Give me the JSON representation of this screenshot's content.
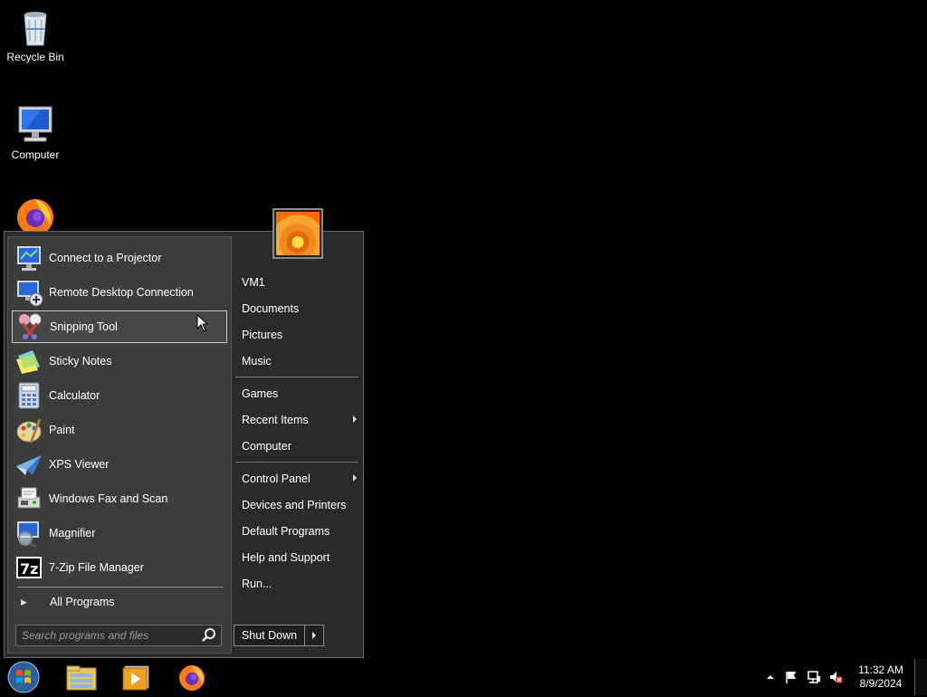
{
  "desktop": {
    "icons": [
      {
        "label": "Recycle Bin",
        "icon": "recycle-bin-icon"
      },
      {
        "label": "Computer",
        "icon": "computer-icon"
      },
      {
        "label": "",
        "icon": "firefox-icon"
      }
    ]
  },
  "start_menu": {
    "programs": [
      {
        "label": "Connect to a Projector",
        "icon": "projector-icon"
      },
      {
        "label": "Remote Desktop Connection",
        "icon": "remote-desktop-icon"
      },
      {
        "label": "Snipping Tool",
        "icon": "scissors-icon",
        "selected": true
      },
      {
        "label": "Sticky Notes",
        "icon": "sticky-notes-icon"
      },
      {
        "label": "Calculator",
        "icon": "calculator-icon"
      },
      {
        "label": "Paint",
        "icon": "paint-palette-icon"
      },
      {
        "label": "XPS Viewer",
        "icon": "paper-plane-icon"
      },
      {
        "label": "Windows Fax and Scan",
        "icon": "fax-icon"
      },
      {
        "label": "Magnifier",
        "icon": "magnifier-icon"
      },
      {
        "label": "7-Zip File Manager",
        "icon": "7zip-icon"
      }
    ],
    "all_programs_label": "All Programs",
    "search_placeholder": "Search programs and files",
    "right_items": [
      {
        "label": "VM1",
        "has_submenu": false
      },
      {
        "label": "Documents",
        "has_submenu": false
      },
      {
        "label": "Pictures",
        "has_submenu": false
      },
      {
        "label": "Music",
        "has_submenu": false
      },
      {
        "label": "Games",
        "has_submenu": false
      },
      {
        "label": "Recent Items",
        "has_submenu": true
      },
      {
        "label": "Computer",
        "has_submenu": false
      },
      {
        "label": "Control Panel",
        "has_submenu": true
      },
      {
        "label": "Devices and Printers",
        "has_submenu": false
      },
      {
        "label": "Default Programs",
        "has_submenu": false
      },
      {
        "label": "Help and Support",
        "has_submenu": false
      },
      {
        "label": "Run...",
        "has_submenu": false
      }
    ],
    "shutdown_label": "Shut Down"
  },
  "taskbar": {
    "pinned": [
      {
        "icon": "windows-explorer-icon"
      },
      {
        "icon": "media-player-icon"
      },
      {
        "icon": "firefox-icon"
      }
    ],
    "tray_icons": [
      "show-hidden-icons-arrow",
      "action-center-flag-icon",
      "network-icon",
      "volume-muted-icon"
    ],
    "clock": {
      "time": "11:32 AM",
      "date": "8/9/2024"
    }
  },
  "colors": {
    "desktop_bg": "#000000",
    "menu_left_bg": "#3c3c3c",
    "menu_right_bg": "#2a2a2a",
    "selected_border": "#c8c8c8"
  }
}
